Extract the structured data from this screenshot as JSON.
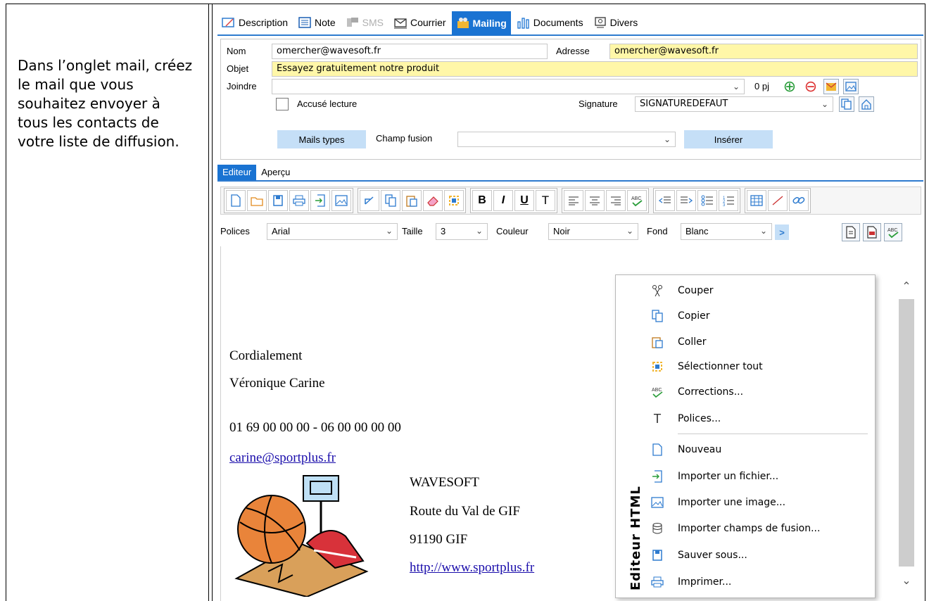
{
  "instructions": "Dans l’onglet mail, créez le mail que vous souhaitez envoyer à tous les contacts de votre liste de diffusion.",
  "tabs": [
    "Description",
    "Note",
    "SMS",
    "Courrier",
    "Mailing",
    "Documents",
    "Divers"
  ],
  "form": {
    "nom_label": "Nom",
    "nom_value": "omercher@wavesoft.fr",
    "adresse_label": "Adresse",
    "adresse_value": "omercher@wavesoft.fr",
    "objet_label": "Objet",
    "objet_value": "Essayez gratuitement notre produit",
    "joindre_label": "Joindre",
    "joindre_value": "",
    "pj_count": "0 pj",
    "accuse_label": "Accusé lecture",
    "signature_label": "Signature",
    "signature_value": "SIGNATUREDEFAUT",
    "mails_types_label": "Mails types",
    "champ_fusion_label": "Champ fusion",
    "champ_fusion_value": "",
    "inserer_label": "Insérer"
  },
  "editor_tabs": [
    "Editeur",
    "Aperçu"
  ],
  "fontrow": {
    "polices_label": "Polices",
    "polices_value": "Arial",
    "taille_label": "Taille",
    "taille_value": "3",
    "couleur_label": "Couleur",
    "couleur_value": "Noir",
    "fond_label": "Fond",
    "fond_value": "Blanc",
    "more": ">"
  },
  "toolbar": {
    "bold": "B",
    "italic": "I",
    "underline": "U",
    "font": "T"
  },
  "content": {
    "greeting": "Cordialement",
    "name": "Véronique Carine",
    "phones": "01 69 00 00 00 - 06 00 00 00 00",
    "email": "carine@sportplus.fr",
    "company": "WAVESOFT",
    "street": "Route du Val de GIF",
    "city": "91190 GIF",
    "website": "http://www.sportplus.fr"
  },
  "context_menu": {
    "side_label": "Editeur HTML",
    "items": [
      "Couper",
      "Copier",
      "Coller",
      "Sélectionner tout",
      "Corrections...",
      "Polices...",
      "Nouveau",
      "Importer un fichier...",
      "Importer une image...",
      "Importer champs de fusion...",
      "Sauver sous...",
      "Imprimer..."
    ]
  },
  "colors": {
    "accent": "#1a73d2",
    "yellow_field": "#fff7a8",
    "button_blue": "#c5dff7"
  }
}
